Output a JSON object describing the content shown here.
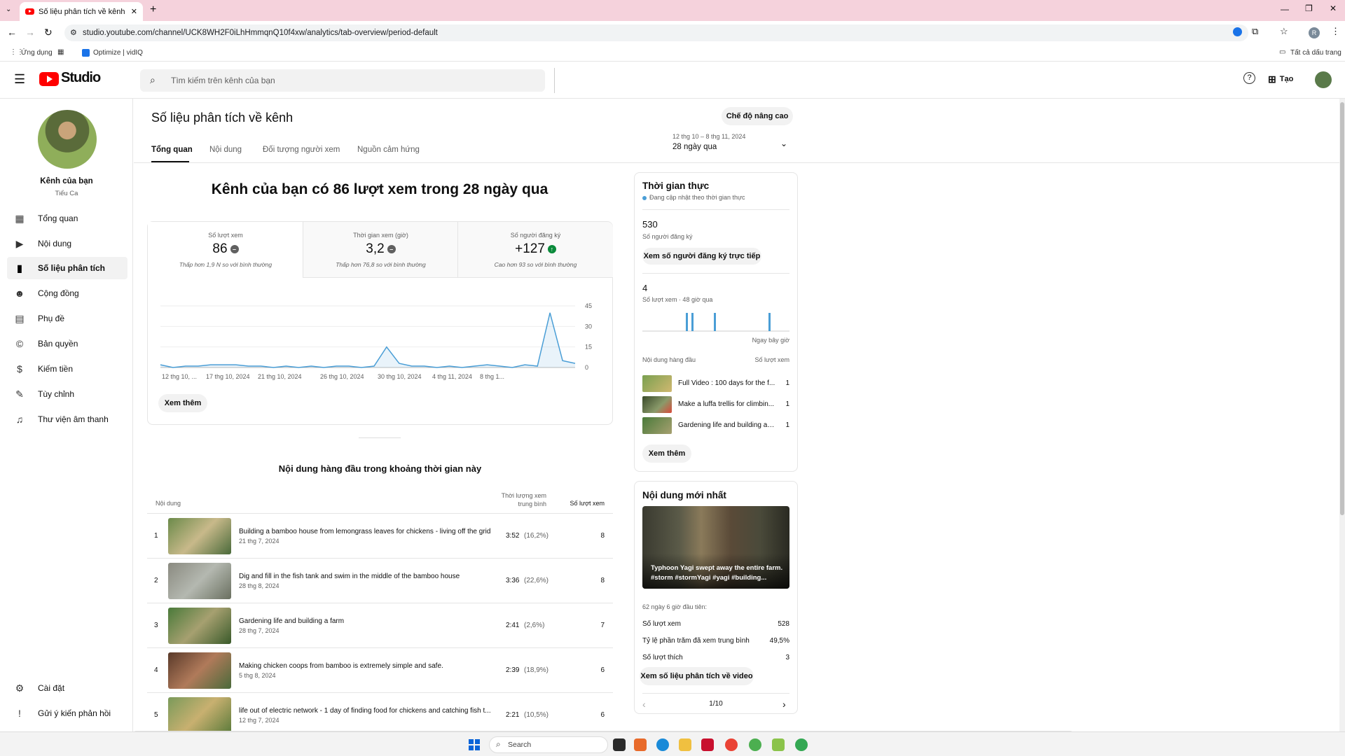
{
  "browser": {
    "tab_title": "Số liệu phân tích về kênh - You",
    "new_tab_symbol": "+",
    "url": "studio.youtube.com/channel/UCK8WH2F0iLhHmmqnQ10f4xw/analytics/tab-overview/period-default",
    "bookmarks": {
      "apps": "Ứng dụng",
      "vidiq": "Optimize | vidIQ",
      "all": "Tất cả dấu trang"
    },
    "profile_initial": "R"
  },
  "header": {
    "logo_text": "Studio",
    "search_placeholder": "Tìm kiếm trên kênh của bạn",
    "create_label": "Tạo"
  },
  "sidebar": {
    "channel_label": "Kênh của bạn",
    "channel_name": "Tiểu Ca",
    "items": [
      {
        "label": "Tổng quan",
        "icon": "dashboard-icon"
      },
      {
        "label": "Nội dung",
        "icon": "content-icon"
      },
      {
        "label": "Số liệu phân tích",
        "icon": "analytics-icon"
      },
      {
        "label": "Cộng đồng",
        "icon": "community-icon"
      },
      {
        "label": "Phụ đề",
        "icon": "subtitles-icon"
      },
      {
        "label": "Bản quyền",
        "icon": "copyright-icon"
      },
      {
        "label": "Kiếm tiền",
        "icon": "earn-icon"
      },
      {
        "label": "Tùy chỉnh",
        "icon": "customization-icon"
      },
      {
        "label": "Thư viện âm thanh",
        "icon": "audio-library-icon"
      }
    ],
    "settings": "Cài đặt",
    "feedback": "Gửi ý kiến phản hồi"
  },
  "page": {
    "title": "Số liệu phân tích về kênh",
    "advanced_mode": "Chế độ nâng cao",
    "tabs": [
      "Tổng quan",
      "Nội dung",
      "Đối tượng người xem",
      "Nguồn cảm hứng"
    ],
    "date_range": "12 thg 10 – 8 thg 11, 2024",
    "period": "28 ngày qua",
    "headline": "Kênh của bạn có 86 lượt xem trong 28 ngày qua"
  },
  "metrics": [
    {
      "label": "Số lượt xem",
      "value": "86",
      "note": "Thấp hơn 1,9 N so với bình thường",
      "status": "neutral"
    },
    {
      "label": "Thời gian xem (giờ)",
      "value": "3,2",
      "note": "Thấp hơn 76,8 so với bình thường",
      "status": "neutral"
    },
    {
      "label": "Số người đăng ký",
      "value": "+127",
      "note": "Cao hơn 93 so với bình thường",
      "status": "up"
    }
  ],
  "chart_data": {
    "type": "line",
    "x_tick_labels": [
      "12 thg 10, ...",
      "17 thg 10, 2024",
      "21 thg 10, 2024",
      "26 thg 10, 2024",
      "30 thg 10, 2024",
      "4 thg 11, 2024",
      "8 thg 1..."
    ],
    "y_ticks": [
      45,
      30,
      15,
      0
    ],
    "ylim": [
      0,
      45
    ],
    "series": [
      {
        "values": [
          2,
          0,
          1,
          1,
          2,
          2,
          2,
          1,
          1,
          0,
          1,
          0,
          1,
          0,
          1,
          1,
          0,
          1,
          15,
          3,
          1,
          1,
          0,
          1,
          0,
          1,
          2,
          1,
          0,
          2,
          1,
          40,
          5,
          3
        ]
      }
    ],
    "color": "#4a9ed6",
    "grid": true
  },
  "see_more": "Xem thêm",
  "top_content": {
    "title": "Nội dung hàng đầu trong khoảng thời gian này",
    "col_content": "Nội dung",
    "col_avg_duration_1": "Thời lượng xem",
    "col_avg_duration_2": "trung bình",
    "col_views": "Số lượt xem",
    "rows": [
      {
        "num": "1",
        "title": "Building a bamboo house from lemongrass leaves for chickens - living off the grid",
        "date": "21 thg 7, 2024",
        "dur": "3:52",
        "pct": "(16,2%)",
        "views": "8"
      },
      {
        "num": "2",
        "title": "Dig and fill in the fish tank and swim in the middle of the bamboo house",
        "date": "28 thg 8, 2024",
        "dur": "3:36",
        "pct": "(22,6%)",
        "views": "8"
      },
      {
        "num": "3",
        "title": "Gardening life and building a farm",
        "date": "28 thg 7, 2024",
        "dur": "2:41",
        "pct": "(2,6%)",
        "views": "7"
      },
      {
        "num": "4",
        "title": "Making chicken coops from bamboo is extremely simple and safe.",
        "date": "5 thg 8, 2024",
        "dur": "2:39",
        "pct": "(18,9%)",
        "views": "6"
      },
      {
        "num": "5",
        "title": "life out of electric network - 1 day of finding food for chickens and catching fish t...",
        "date": "12 thg 7, 2024",
        "dur": "2:21",
        "pct": "(10,5%)",
        "views": "6"
      }
    ]
  },
  "realtime": {
    "title": "Thời gian thực",
    "live_note": "Đang cập nhật theo thời gian thực",
    "subs_value": "530",
    "subs_label": "Số người đăng ký",
    "live_subs_button": "Xem số người đăng ký trực tiếp",
    "views_value": "4",
    "views_label": "Số lượt xem · 48 giờ qua",
    "now_label": "Ngay bây giờ",
    "bars": [
      1,
      1,
      1,
      1
    ],
    "top_label": "Nội dung hàng đầu",
    "views_col": "Số lượt xem",
    "items": [
      {
        "title": "Full Video : 100 days for the f...",
        "views": "1"
      },
      {
        "title": "Make a luffa trellis for climbin...",
        "views": "1"
      },
      {
        "title": "Gardening life and building a f...",
        "views": "1"
      }
    ],
    "see_more": "Xem thêm"
  },
  "latest": {
    "title": "Nội dung mới nhất",
    "video_caption": "Typhoon Yagi swept away the entire farm. #storm #stormYagi #yagi #building...",
    "since": "62 ngày 6 giờ đầu tiên:",
    "stats": [
      {
        "label": "Số lượt xem",
        "value": "528"
      },
      {
        "label": "Tỷ lệ phần trăm đã xem trung bình",
        "value": "49,5%"
      },
      {
        "label": "Số lượt thích",
        "value": "3"
      }
    ],
    "button": "Xem số liệu phân tích về video",
    "pager": "1/10"
  },
  "taskbar": {
    "search": "Search"
  }
}
